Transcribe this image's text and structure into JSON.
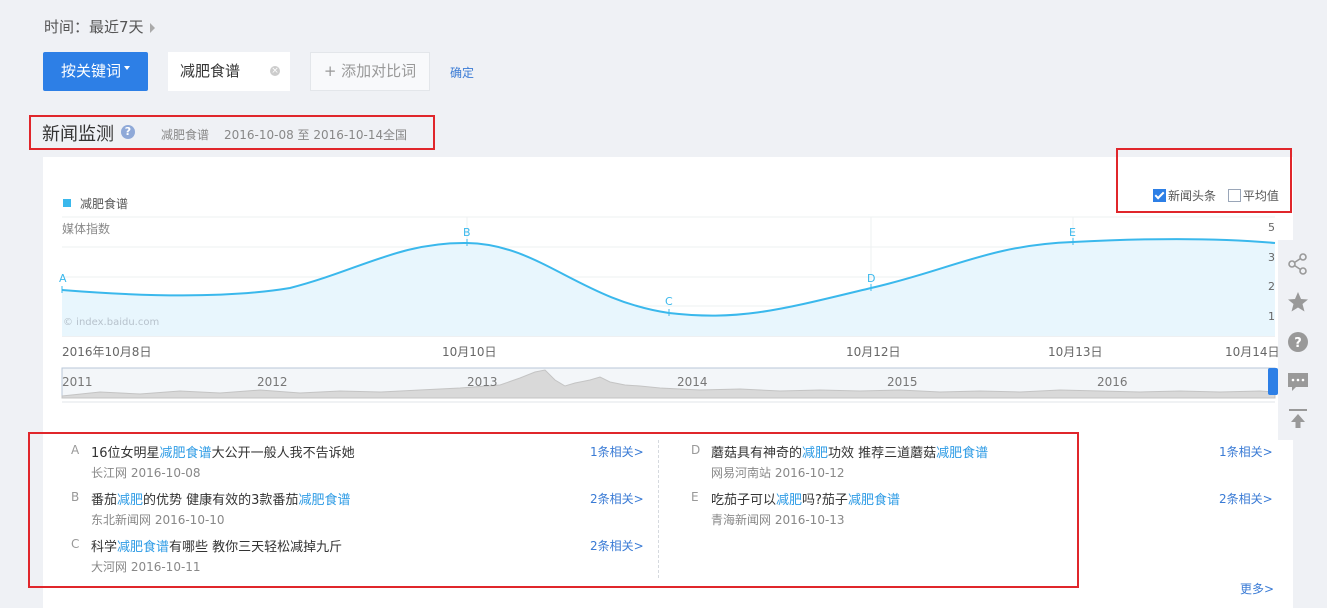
{
  "time": {
    "label": "时间：最近7天"
  },
  "toolbar": {
    "mode_label": "按关键词",
    "keyword": "减肥食谱",
    "add_label": "+ 添加对比词",
    "confirm_label": "确定"
  },
  "section": {
    "title": "新闻监测",
    "keyword": "减肥食谱",
    "date_range": "2016-10-08 至 2016-10-14",
    "region": "全国"
  },
  "chart_controls": {
    "headline_label": "新闻头条",
    "headline_checked": true,
    "average_label": "平均值",
    "average_checked": false
  },
  "chart_data": {
    "type": "line",
    "legend": [
      "减肥食谱"
    ],
    "ylabel": "媒体指数",
    "watermark": "© index.baidu.com",
    "y_ticks": [
      "5",
      "3",
      "2",
      "1"
    ],
    "x_ticks": [
      "2016年10月8日",
      "10月10日",
      "10月12日",
      "10月13日",
      "10月14日"
    ],
    "series": [
      {
        "name": "减肥食谱",
        "color": "#3ab8ec",
        "x": [
          "2016-10-08",
          "2016-10-09",
          "2016-10-10",
          "2016-10-11",
          "2016-10-12",
          "2016-10-13",
          "2016-10-14"
        ],
        "values": [
          2.2,
          2.0,
          3.8,
          1.1,
          2.0,
          3.8,
          3.8
        ]
      }
    ],
    "markers": [
      "A",
      "B",
      "C",
      "D",
      "E"
    ],
    "overview_years": [
      "2011",
      "2012",
      "2013",
      "2014",
      "2015",
      "2016"
    ]
  },
  "news": {
    "left": [
      {
        "letter": "A",
        "parts": [
          {
            "t": "16位女明星",
            "h": false
          },
          {
            "t": "减肥食谱",
            "h": true
          },
          {
            "t": "大公开一般人我不告诉她",
            "h": false
          }
        ],
        "source": "长江网 2016-10-08",
        "related": "1条相关>"
      },
      {
        "letter": "B",
        "parts": [
          {
            "t": "番茄",
            "h": false
          },
          {
            "t": "减肥",
            "h": true
          },
          {
            "t": "的优势 健康有效的3款番茄",
            "h": false
          },
          {
            "t": "减肥食谱",
            "h": true
          }
        ],
        "source": "东北新闻网 2016-10-10",
        "related": "2条相关>"
      },
      {
        "letter": "C",
        "parts": [
          {
            "t": "科学",
            "h": false
          },
          {
            "t": "减肥食谱",
            "h": true
          },
          {
            "t": "有哪些 教你三天轻松减掉九斤",
            "h": false
          }
        ],
        "source": "大河网 2016-10-11",
        "related": "2条相关>"
      }
    ],
    "right": [
      {
        "letter": "D",
        "parts": [
          {
            "t": "蘑菇具有神奇的",
            "h": false
          },
          {
            "t": "减肥",
            "h": true
          },
          {
            "t": "功效 推荐三道蘑菇",
            "h": false
          },
          {
            "t": "减肥食谱",
            "h": true
          }
        ],
        "source": "网易河南站 2016-10-12",
        "related": "1条相关>"
      },
      {
        "letter": "E",
        "parts": [
          {
            "t": "吃茄子可以",
            "h": false
          },
          {
            "t": "减肥",
            "h": true
          },
          {
            "t": "吗?茄子",
            "h": false
          },
          {
            "t": "减肥食谱",
            "h": true
          }
        ],
        "source": "青海新闻网 2016-10-13",
        "related": "2条相关>"
      }
    ],
    "more_label": "更多>"
  },
  "sidebar_icons": [
    "share-icon",
    "star-icon",
    "help-icon",
    "comment-icon",
    "back-to-top-icon"
  ]
}
